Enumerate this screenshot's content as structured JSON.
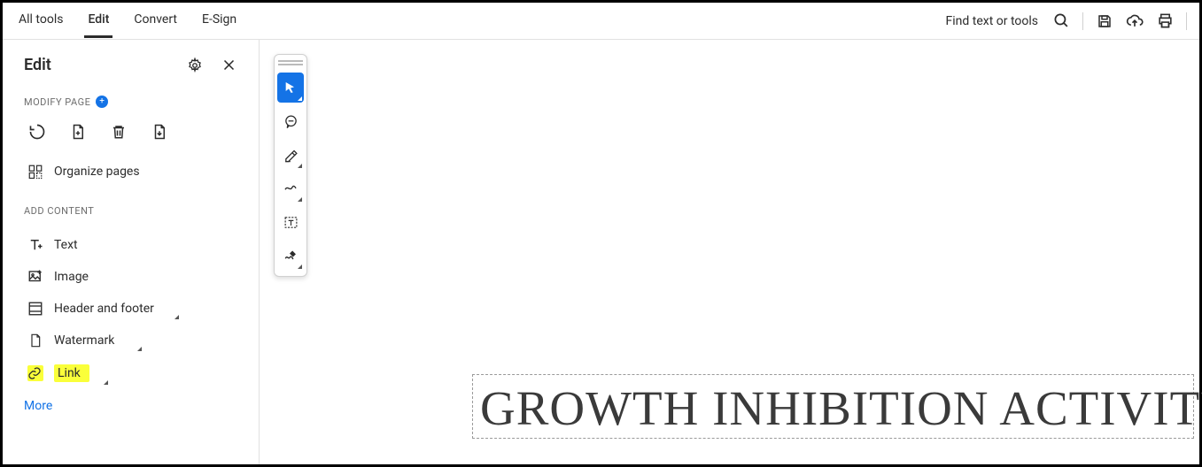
{
  "menubar": {
    "items": [
      "All tools",
      "Edit",
      "Convert",
      "E-Sign"
    ],
    "active_index": 1,
    "find_label": "Find text or tools"
  },
  "sidebar": {
    "title": "Edit",
    "section_modify": "MODIFY PAGE",
    "organize_label": "Organize pages",
    "section_add": "ADD CONTENT",
    "items": {
      "text": "Text",
      "image": "Image",
      "header_footer": "Header and footer",
      "watermark": "Watermark",
      "link": "Link"
    },
    "more_label": "More"
  },
  "document": {
    "text": "GROWTH INHIBITION ACTIVITY"
  }
}
